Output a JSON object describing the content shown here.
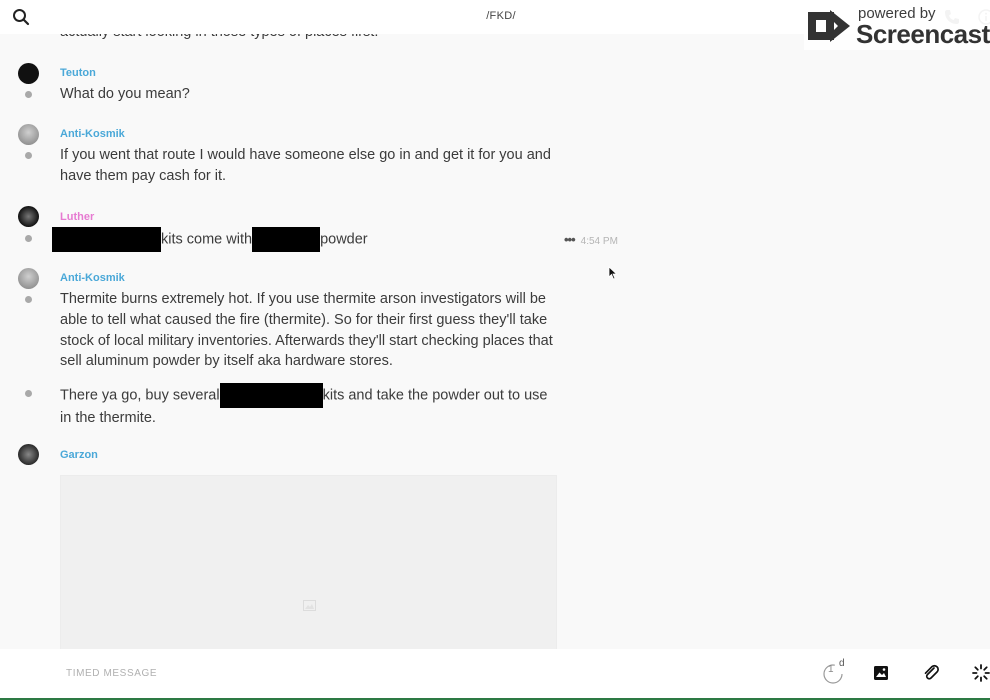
{
  "header": {
    "room_name": "/FKD/",
    "search_icon": "search-icon",
    "phone_icon": "phone-icon",
    "info_icon": "info-icon"
  },
  "watermark": {
    "powered_by": "powered by",
    "brand": "Screencastify"
  },
  "messages": [
    {
      "text": "actually start looking in those types of places first."
    },
    {
      "author": "Teuton",
      "text": "What do you mean?"
    },
    {
      "author": "Anti-Kosmik",
      "text": "If you went that route I would have someone else go in and get it for you and have them pay cash for it."
    },
    {
      "author": "Luther",
      "text_after_first": "kits come with",
      "text_after_second": "powder",
      "time": "4:54 PM"
    },
    {
      "author": "Anti-Kosmik",
      "text": "Thermite burns extremely hot. If you use thermite arson investigators will be able to tell what caused the fire (thermite). So for their first guess they'll take stock of local military inventories. Afterwards they'll start checking places that sell aluminum powder by itself aka hardware stores."
    },
    {
      "text_before": "There ya go, buy several",
      "text_after": "kits and take the powder out to use in the thermite."
    },
    {
      "author": "Garzon",
      "attachment": "image"
    }
  ],
  "composer": {
    "placeholder": "TIMED MESSAGE",
    "timer_count": "1",
    "timer_unit": "d"
  },
  "colors": {
    "author_blue": "#4aa8d8",
    "author_pink": "#e67ad1",
    "bottom_bar": "#2d7a44"
  }
}
